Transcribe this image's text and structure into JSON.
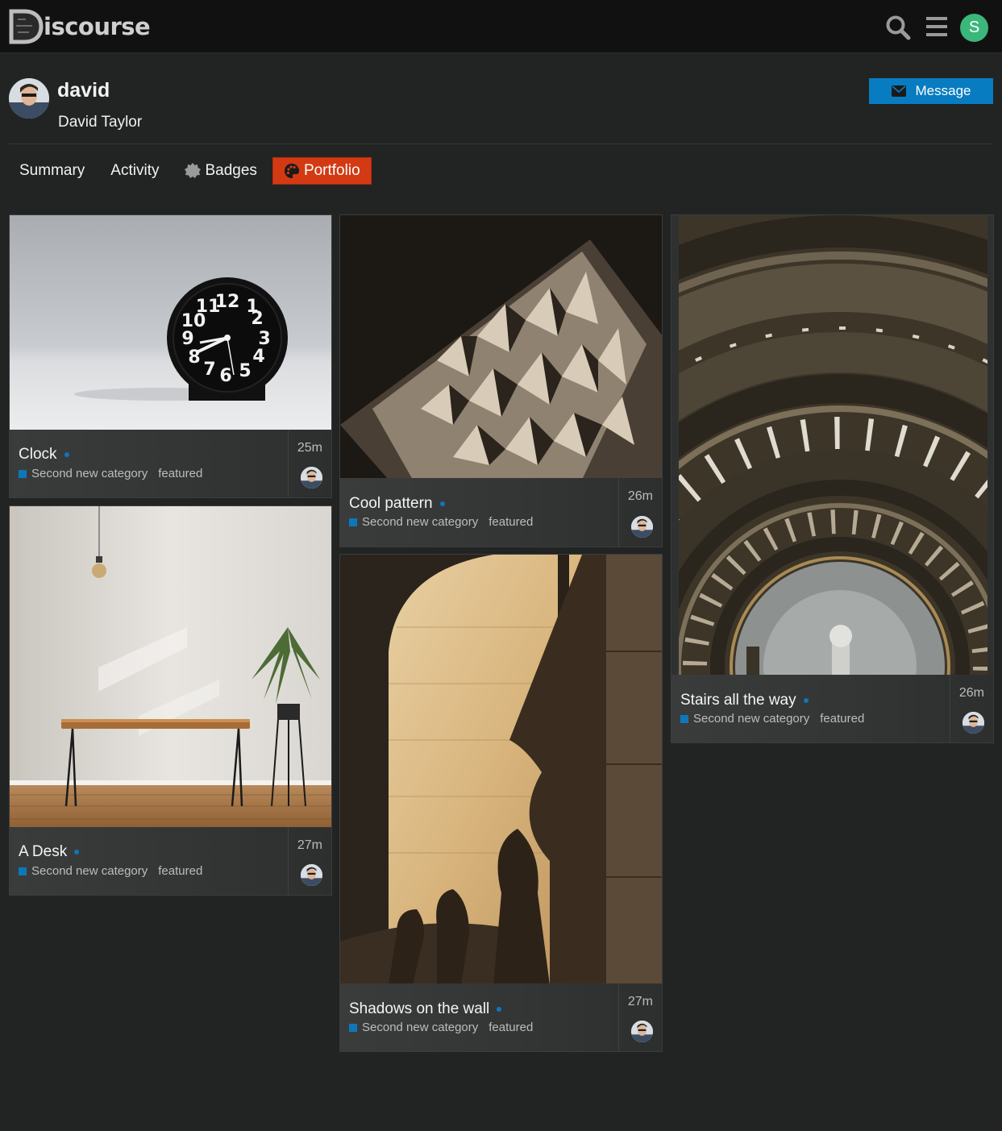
{
  "header": {
    "logo_text": "iscourse",
    "user_initial": "S",
    "icons": {
      "search": "search-icon",
      "menu": "hamburger-menu-icon"
    },
    "colors": {
      "avatar_bg": "#3bb77a"
    }
  },
  "profile": {
    "username": "david",
    "full_name": "David Taylor",
    "message_label": "Message"
  },
  "nav": {
    "summary": "Summary",
    "activity": "Activity",
    "badges": "Badges",
    "portfolio": "Portfolio"
  },
  "colors": {
    "accent_active_tab": "#d33a14",
    "primary_button": "#087cc1",
    "category": "#0e77b9"
  },
  "topics": [
    {
      "title": "Clock",
      "category": "Second new category",
      "tag": "featured",
      "age": "25m",
      "image": "alarm-clock-photo"
    },
    {
      "title": "A Desk",
      "category": "Second new category",
      "tag": "featured",
      "age": "27m",
      "image": "wooden-desk-photo"
    },
    {
      "title": "Cool pattern",
      "category": "Second new category",
      "tag": "featured",
      "age": "26m",
      "image": "geometric-wall-pattern-photo"
    },
    {
      "title": "Shadows on the wall",
      "category": "Second new category",
      "tag": "featured",
      "age": "27m",
      "image": "wall-shadows-photo"
    },
    {
      "title": "Stairs all the way",
      "category": "Second new category",
      "tag": "featured",
      "age": "26m",
      "image": "spiral-staircase-photo"
    }
  ]
}
